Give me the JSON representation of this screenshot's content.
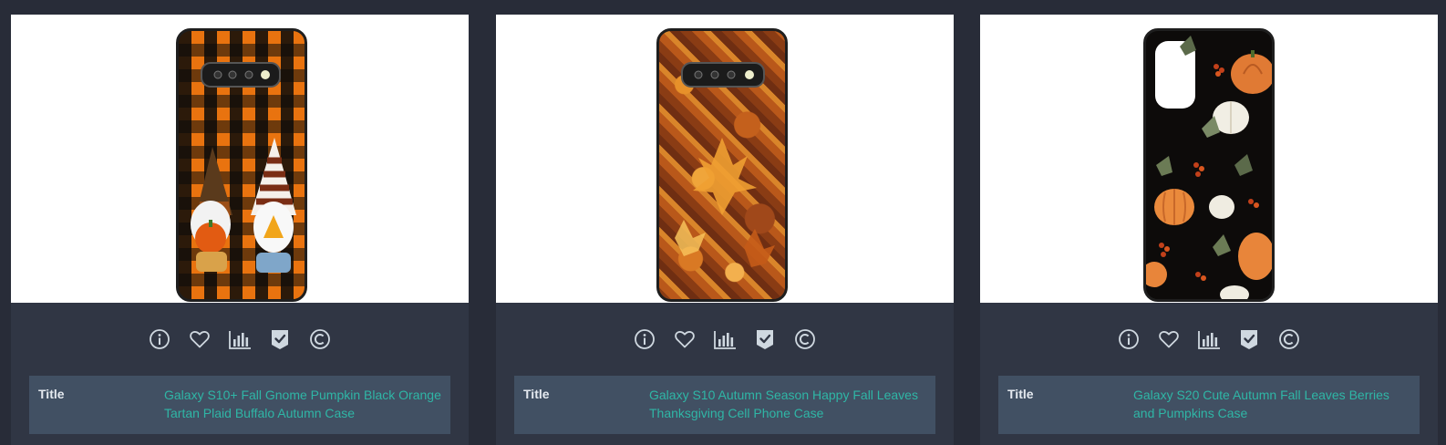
{
  "products": [
    {
      "image_icon": "phone-case-gnome-plaid-image",
      "title_label": "Title",
      "title": "Galaxy S10+ Fall Gnome Pumpkin Black Orange Tartan Plaid Buffalo Autumn Case"
    },
    {
      "image_icon": "phone-case-autumn-leaves-image",
      "title_label": "Title",
      "title": "Galaxy S10 Autumn Season Happy Fall Leaves Thanksgiving Cell Phone Case"
    },
    {
      "image_icon": "phone-case-pumpkins-berries-image",
      "title_label": "Title",
      "title": "Galaxy S20 Cute Autumn Fall Leaves Berries and Pumpkins Case"
    }
  ],
  "action_icons": [
    "info-icon",
    "heart-icon",
    "bar-chart-icon",
    "check-shield-icon",
    "copyright-icon"
  ],
  "colors": {
    "background": "#282c38",
    "card": "#303644",
    "info_panel": "#415063",
    "accent_teal": "#2fb6a6",
    "icon": "#cfd8e0"
  }
}
